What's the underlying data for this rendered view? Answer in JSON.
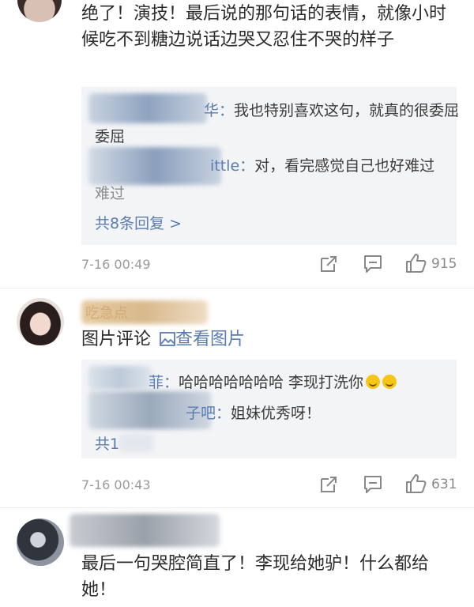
{
  "comment1": {
    "text": "绝了！演技！最后说的那句话的表情，就像小时候吃不到糖边说话边哭又忍住不哭的样子",
    "replies": [
      {
        "name": "华：",
        "text": "我也特别喜欢这句，就真的很委屈"
      },
      {
        "name": "ittle：",
        "text": "对，看完感觉自己也好难过"
      }
    ],
    "more_replies": "共8条回复 >",
    "time": "7-16 00:49",
    "likes": "915"
  },
  "comment2": {
    "username": "吃急点",
    "text_prefix": "图片评论",
    "image_link": "查看图片",
    "replies": [
      {
        "name": "菲：",
        "text": "哈哈哈哈哈哈哈 李现打洗你"
      },
      {
        "name": "子吧：",
        "text": "姐妹优秀呀！"
      }
    ],
    "more_replies": "共1",
    "time": "7-16 00:43",
    "likes": "631"
  },
  "comment3": {
    "text": "最后一句哭腔简直了！李现给她驴！什么都给她！"
  },
  "icons": {
    "share": "share-icon",
    "comment": "comment-icon",
    "like": "thumbs-up-icon",
    "image": "image-icon"
  },
  "colors": {
    "link": "#5a7cb0",
    "meta": "#9a9a9a",
    "reply_bg": "#f3f4f6"
  }
}
